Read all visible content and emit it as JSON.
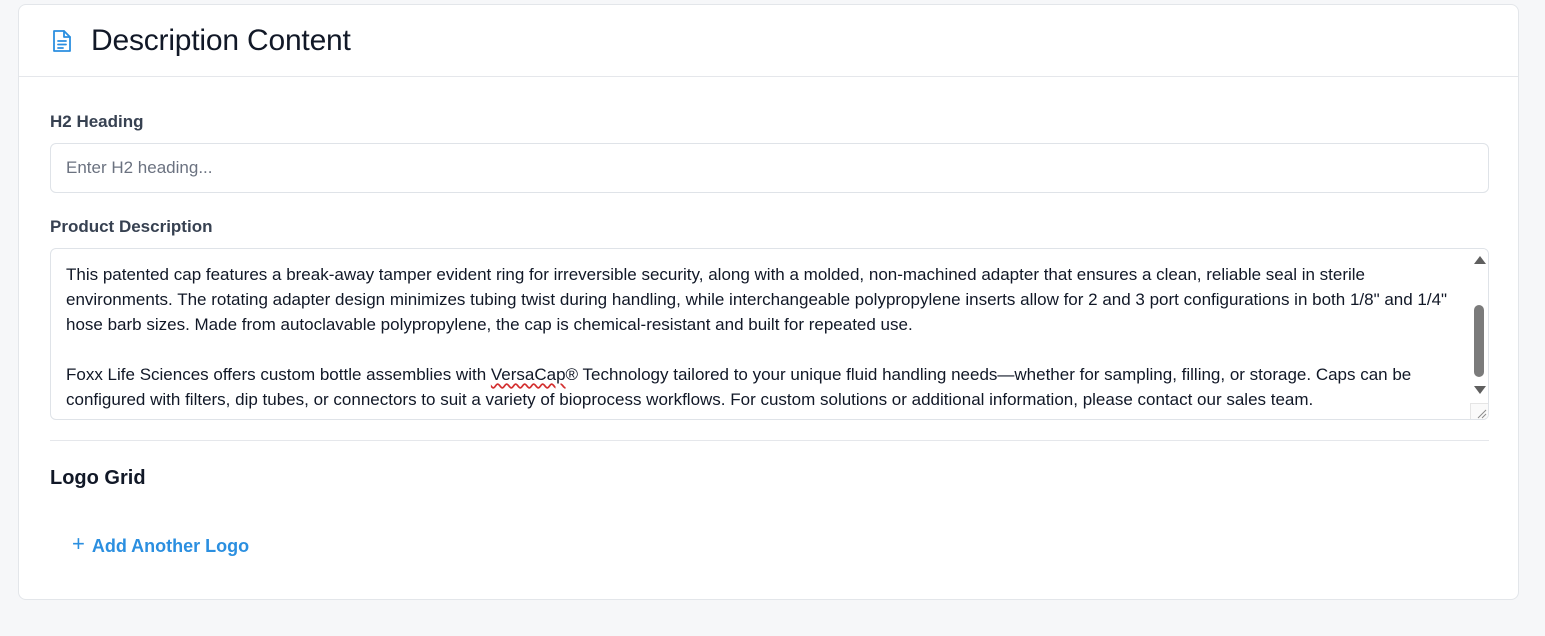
{
  "header": {
    "icon": "document-icon",
    "title": "Description Content"
  },
  "h2_field": {
    "label": "H2 Heading",
    "placeholder": "Enter H2 heading...",
    "value": ""
  },
  "description_field": {
    "label": "Product Description",
    "paragraph_1": "This patented cap features a break-away tamper evident ring for irreversible security, along with a molded, non-machined adapter that ensures a clean, reliable seal in sterile environments. The rotating adapter design minimizes tubing twist during handling, while interchangeable polypropylene inserts allow for 2 and 3 port configurations in both 1/8\" and 1/4\" hose barb sizes. Made from autoclavable polypropylene, the cap is chemical-resistant and built for repeated use.",
    "paragraph_2_before": "Foxx Life Sciences offers custom bottle assemblies with ",
    "paragraph_2_spell": "VersaCap",
    "paragraph_2_after": "® Technology tailored to your unique fluid handling needs—whether for sampling, filling, or storage. Caps can be configured with filters, dip tubes, or connectors to suit a variety of bioprocess workflows. For custom solutions or additional information, please contact our sales team."
  },
  "logo_grid": {
    "title": "Logo Grid",
    "add_button_icon": "+",
    "add_button_label": "Add Another Logo"
  },
  "colors": {
    "accent": "#2b8fe0",
    "page_background": "#f6f7f9",
    "card_background": "#ffffff"
  }
}
